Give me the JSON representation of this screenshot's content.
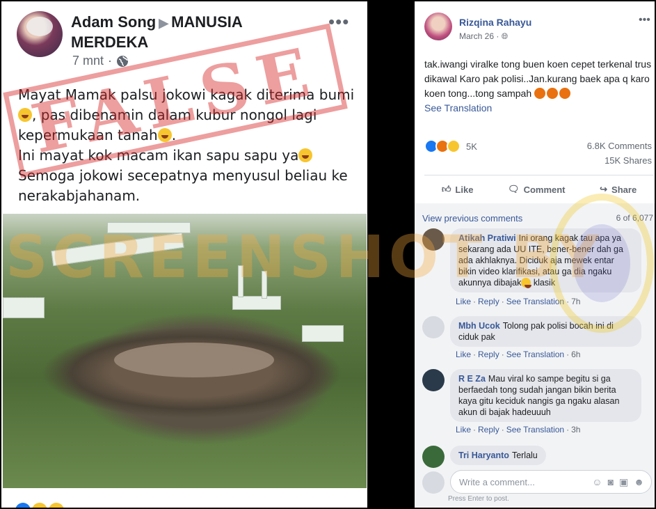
{
  "left_post": {
    "author": "Adam Song",
    "group": "MANUSIA MERDEKA",
    "time": "7 mnt",
    "text_lines": [
      "Mayat Mamak palsu jokowi  kagak diterima bumi",
      ", pas dibenamin dalam kubur nongol lagi",
      "kepermukaan tanah",
      ".",
      "Ini mayat kok macam ikan sapu sapu ya",
      " Semoga jokowi secepatnya menyusul beliau ke",
      "nerakabjahanam."
    ],
    "stamp_text": "FALSE"
  },
  "watermark": "SCREENSHOT BY",
  "right_post": {
    "author": "Rizqina Rahayu",
    "date": "March 26",
    "text": "tak.iwangi viralke tong buen koen cepet terkenal trus dikawal Karo pak polisi..Jan.kurang baek apa q karo koen tong...tong sampah",
    "see_translation": "See Translation",
    "reaction_count": "5K",
    "comments_count": "6.8K Comments",
    "shares_count": "15K Shares",
    "actions": {
      "like": "Like",
      "comment": "Comment",
      "share": "Share"
    },
    "view_previous": "View previous comments",
    "page_info": "6 of 6,077",
    "comments": [
      {
        "author": "Atikah Pratiwi",
        "text": "Ini orang kagak tau apa ya sekarang ada UU ITE, bener-bener dah ga ada akhlaknya. Diciduk aja mewek entar bikin video klarifikasi, atau ga dia ngaku akunnya dibajak",
        "tail": " klasik",
        "like": "Like",
        "reply": "Reply",
        "translate": "See Translation",
        "time": "7h"
      },
      {
        "author": "Mbh Ucok",
        "text": "Tolong pak polisi bocah ini di ciduk pak",
        "like": "Like",
        "reply": "Reply",
        "translate": "See Translation",
        "time": "6h"
      },
      {
        "author": "R E Za",
        "text": "Mau viral ko sampe begitu si ga berfaedah tong sudah jangan bikin berita kaya gitu keciduk nangis ga ngaku alasan akun di bajak hadeuuuh",
        "like": "Like",
        "reply": "Reply",
        "translate": "See Translation",
        "time": "3h"
      },
      {
        "author": "Tri Haryanto",
        "text": "Terlalu"
      }
    ],
    "write_placeholder": "Write a comment...",
    "press_enter": "Press Enter to post."
  }
}
